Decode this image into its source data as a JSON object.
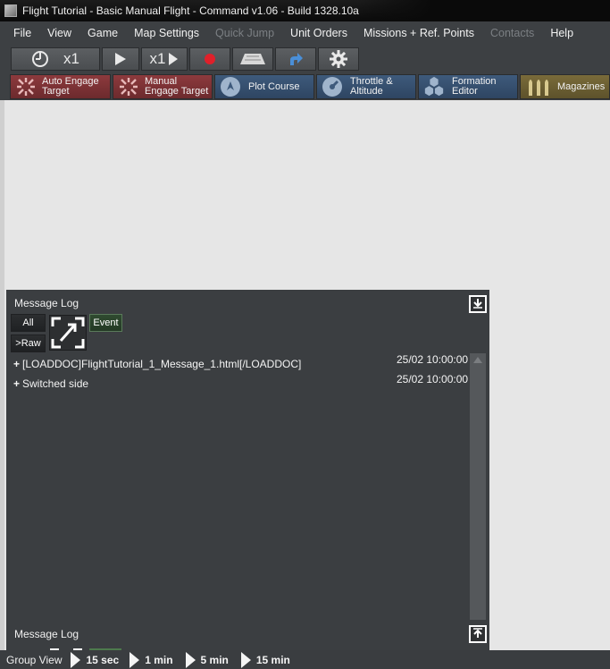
{
  "window": {
    "title": "Flight Tutorial - Basic Manual Flight - Command v1.06 - Build 1328.10a"
  },
  "menu": {
    "items": [
      {
        "label": "File",
        "enabled": true
      },
      {
        "label": "View",
        "enabled": true
      },
      {
        "label": "Game",
        "enabled": true
      },
      {
        "label": "Map Settings",
        "enabled": true
      },
      {
        "label": "Quick Jump",
        "enabled": false
      },
      {
        "label": "Unit Orders",
        "enabled": true
      },
      {
        "label": "Missions + Ref. Points",
        "enabled": true
      },
      {
        "label": "Contacts",
        "enabled": false
      },
      {
        "label": "Help",
        "enabled": true
      }
    ]
  },
  "toolbar": {
    "time_compression": "x1",
    "step_label": "x1",
    "icons": [
      "clock-icon",
      "play-icon",
      "step-forward-icon",
      "record-icon",
      "terrain-icon",
      "arrow-icon",
      "gear-icon"
    ]
  },
  "actionbar": {
    "auto_engage": "Auto Engage\nTarget",
    "manual_engage": "Manual\nEngage Target",
    "plot_course": "Plot Course",
    "throttle": "Throttle &\nAltitude",
    "formation": "Formation\nEditor",
    "magazines": "Magazines"
  },
  "message_log": {
    "header": "Message Log",
    "footer": "Message Log",
    "filters": {
      "all": "All",
      "raw": ">Raw",
      "event": "Event"
    },
    "entries": [
      {
        "text": "[LOADDOC]FlightTutorial_1_Message_1.html[/LOADDOC]",
        "time": "25/02 10:00:00"
      },
      {
        "text": "Switched side",
        "time": "25/02 10:00:00"
      }
    ]
  },
  "statusbar": {
    "group_view": "Group View",
    "time_steps": [
      "15 sec",
      "1 min",
      "5 min",
      "15 min"
    ]
  },
  "colors": {
    "panel": "#3b3e41",
    "map": "#e6e6e6",
    "engage_red": "#8d3a3d",
    "action_blue": "#3e5a7c",
    "magazine_gold": "#7a6b3a",
    "record_red": "#e0202a"
  }
}
